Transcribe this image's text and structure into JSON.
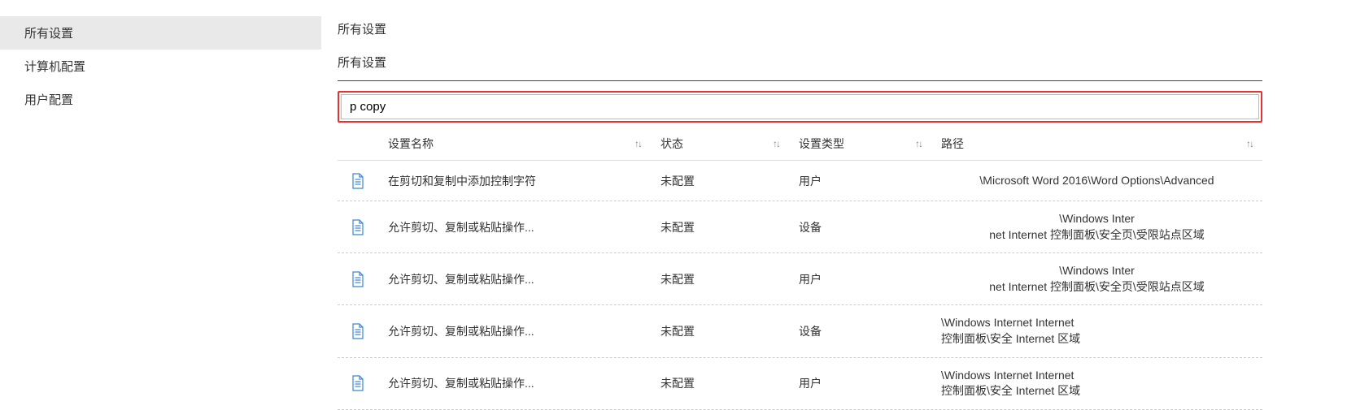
{
  "sidebar": {
    "items": [
      {
        "label": "所有设置",
        "selected": true
      },
      {
        "label": "计算机配置",
        "selected": false
      },
      {
        "label": "用户配置",
        "selected": false
      }
    ]
  },
  "main": {
    "title": "所有设置",
    "subtitle": "所有设置",
    "search_value": "p copy",
    "columns": {
      "name": "设置名称",
      "state": "状态",
      "type": "设置类型",
      "path": "路径"
    },
    "sort_glyph": "↑↓",
    "rows": [
      {
        "name": "在剪切和复制中添加控制字符",
        "state": "未配置",
        "type": "用户",
        "path": "\\Microsoft Word 2016\\Word Options\\Advanced",
        "path_align": "center"
      },
      {
        "name": "允许剪切、复制或粘贴操作...",
        "state": "未配置",
        "type": "设备",
        "path": "\\Windows Inter\nnet Internet 控制面板\\安全页\\受限站点区域",
        "path_align": "center"
      },
      {
        "name": "允许剪切、复制或粘贴操作...",
        "state": "未配置",
        "type": "用户",
        "path": "\\Windows Inter\nnet Internet 控制面板\\安全页\\受限站点区域",
        "path_align": "center"
      },
      {
        "name": "允许剪切、复制或粘贴操作...",
        "state": "未配置",
        "type": "设备",
        "path": "\\Windows Internet Internet\n控制面板\\安全 Internet 区域",
        "path_align": "left"
      },
      {
        "name": "允许剪切、复制或粘贴操作...",
        "state": "未配置",
        "type": "用户",
        "path": "\\Windows Internet Internet\n控制面板\\安全 Internet 区域",
        "path_align": "left"
      }
    ]
  }
}
